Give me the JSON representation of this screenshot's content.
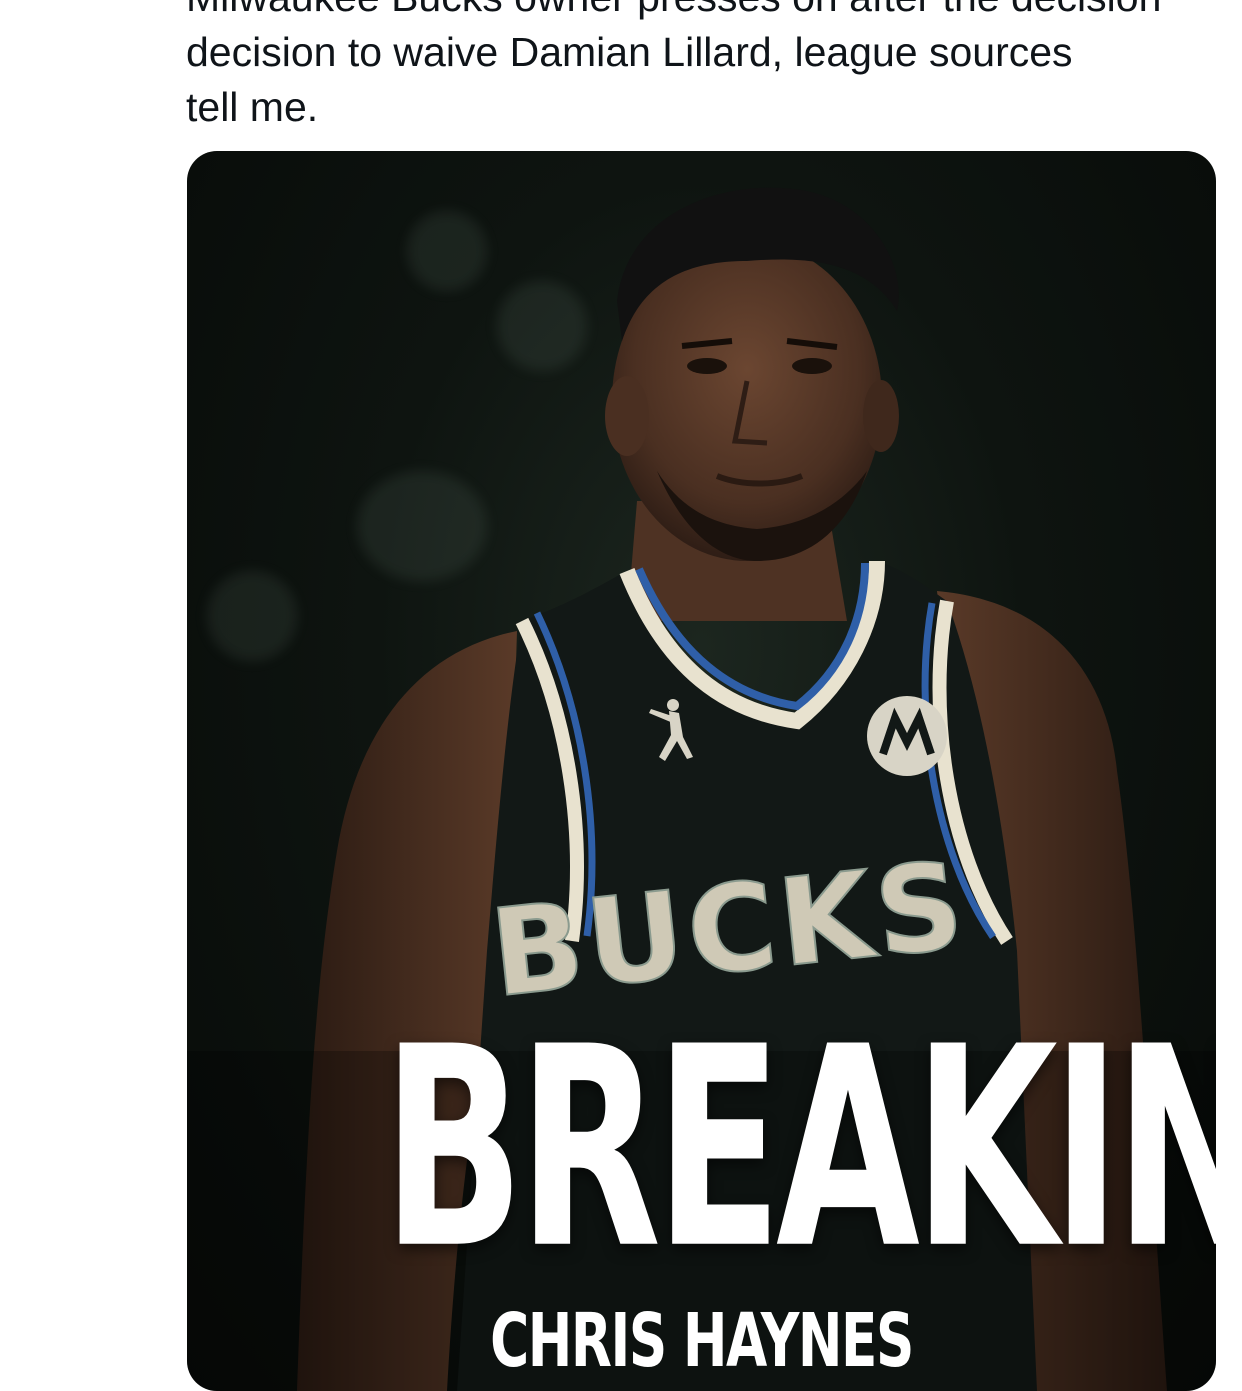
{
  "tweet": {
    "text_lines": [
      "Milwaukee Bucks owner presses on after the decision",
      "decision to waive Damian Lillard, league sources",
      "tell me."
    ]
  },
  "media": {
    "headline": "BREAKING",
    "byline": "CHRIS HAYNES",
    "jersey_wordmark": "BUCKS",
    "colors": {
      "background": "#0b100d",
      "jersey": "#121816",
      "trim_cream": "#e8e2cf",
      "trim_blue": "#2f5fa8",
      "skin": "#5a3a28"
    }
  }
}
